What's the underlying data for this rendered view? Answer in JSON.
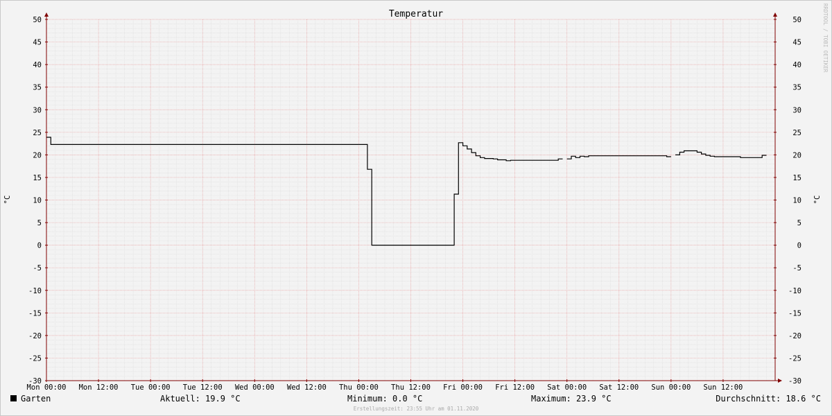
{
  "chart_data": {
    "type": "line",
    "title": "Temperatur",
    "ylabel": "°C",
    "ylabel_right": "°C",
    "ylim": [
      -30,
      50
    ],
    "xlim_hours": [
      0,
      168
    ],
    "y_ticks": [
      50,
      45,
      40,
      35,
      30,
      25,
      20,
      15,
      10,
      5,
      0,
      -5,
      -10,
      -15,
      -20,
      -25,
      -30
    ],
    "x_ticks": [
      {
        "label": "Mon 00:00",
        "hour": 0
      },
      {
        "label": "Mon 12:00",
        "hour": 12
      },
      {
        "label": "Tue 00:00",
        "hour": 24
      },
      {
        "label": "Tue 12:00",
        "hour": 36
      },
      {
        "label": "Wed 00:00",
        "hour": 48
      },
      {
        "label": "Wed 12:00",
        "hour": 60
      },
      {
        "label": "Thu 00:00",
        "hour": 72
      },
      {
        "label": "Thu 12:00",
        "hour": 84
      },
      {
        "label": "Fri 00:00",
        "hour": 96
      },
      {
        "label": "Fri 12:00",
        "hour": 108
      },
      {
        "label": "Sat 00:00",
        "hour": 120
      },
      {
        "label": "Sat 12:00",
        "hour": 132
      },
      {
        "label": "Sun 00:00",
        "hour": 144
      },
      {
        "label": "Sun 12:00",
        "hour": 156
      }
    ],
    "grid": true,
    "series": [
      {
        "name": "Garten",
        "color": "#000000",
        "segments": [
          [
            [
              0,
              23.9
            ],
            [
              1,
              23.9
            ],
            [
              1,
              22.3
            ],
            [
              74,
              22.3
            ],
            [
              74,
              16.8
            ],
            [
              75,
              16.8
            ],
            [
              75,
              0
            ],
            [
              94,
              0
            ],
            [
              94,
              11.3
            ],
            [
              95,
              11.3
            ],
            [
              95,
              22.7
            ],
            [
              96,
              22.7
            ],
            [
              96,
              22
            ],
            [
              97,
              22
            ],
            [
              97,
              21.3
            ],
            [
              98,
              21.3
            ],
            [
              98,
              20.5
            ],
            [
              99,
              20.5
            ],
            [
              99,
              19.8
            ],
            [
              100,
              19.8
            ],
            [
              100,
              19.4
            ],
            [
              101,
              19.4
            ],
            [
              101,
              19.2
            ],
            [
              103,
              19.2
            ],
            [
              103,
              19.1
            ],
            [
              104,
              19.1
            ],
            [
              104,
              18.9
            ],
            [
              106,
              18.9
            ],
            [
              106,
              18.7
            ],
            [
              107,
              18.7
            ],
            [
              107,
              18.8
            ],
            [
              118,
              18.8
            ],
            [
              118,
              19.1
            ],
            [
              119,
              19.1
            ]
          ],
          [
            [
              120,
              19.1
            ],
            [
              121,
              19.1
            ],
            [
              121,
              19.7
            ],
            [
              122,
              19.7
            ],
            [
              122,
              19.4
            ],
            [
              123,
              19.4
            ],
            [
              123,
              19.7
            ],
            [
              124,
              19.7
            ],
            [
              124,
              19.6
            ],
            [
              125,
              19.6
            ],
            [
              125,
              19.8
            ],
            [
              143,
              19.8
            ],
            [
              143,
              19.6
            ],
            [
              144,
              19.6
            ]
          ],
          [
            [
              145,
              20
            ],
            [
              146,
              20
            ],
            [
              146,
              20.6
            ],
            [
              147,
              20.6
            ],
            [
              147,
              20.9
            ],
            [
              150,
              20.9
            ],
            [
              150,
              20.6
            ],
            [
              151,
              20.6
            ],
            [
              151,
              20.2
            ],
            [
              152,
              20.2
            ],
            [
              152,
              19.9
            ],
            [
              153,
              19.9
            ],
            [
              153,
              19.7
            ],
            [
              154,
              19.7
            ],
            [
              154,
              19.6
            ],
            [
              160,
              19.6
            ],
            [
              160,
              19.4
            ],
            [
              165,
              19.4
            ],
            [
              165,
              19.9
            ],
            [
              166,
              19.9
            ]
          ]
        ]
      }
    ]
  },
  "legend": {
    "series_name": "Garten",
    "current": "Aktuell: 19.9 °C",
    "minimum": "Minimum: 0.0 °C",
    "maximum": "Maximum: 23.9 °C",
    "average": "Durchschnitt: 18.6 °C"
  },
  "footer": "Erstellungszeit: 23:55 Uhr am 01.11.2020",
  "watermark": "RRDTOOL / TOBI OETIKER"
}
